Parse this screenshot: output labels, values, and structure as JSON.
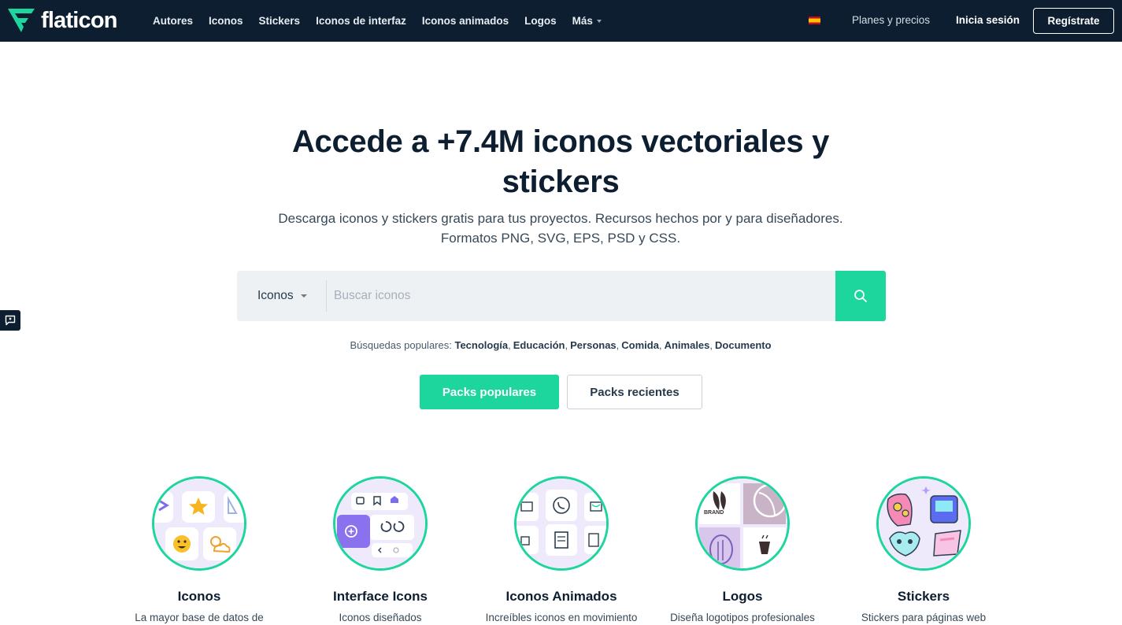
{
  "header": {
    "logo_text": "flaticon",
    "nav": [
      {
        "label": "Autores"
      },
      {
        "label": "Iconos"
      },
      {
        "label": "Stickers"
      },
      {
        "label": "Iconos de interfaz"
      },
      {
        "label": "Iconos animados"
      },
      {
        "label": "Logos"
      },
      {
        "label": "Más"
      }
    ],
    "language_flag_icon": "spain-flag-icon",
    "pricing_label": "Planes y precios",
    "login_label": "Inicia sesión",
    "register_label": "Regístrate"
  },
  "hero": {
    "title_line1": "Accede a +7.4M iconos vectoriales y",
    "title_line2": "stickers",
    "subtitle_line1": "Descarga iconos y stickers gratis para tus proyectos. Recursos hechos por y para diseñadores.",
    "subtitle_line2": "Formatos PNG, SVG, EPS, PSD y CSS."
  },
  "search": {
    "type_selected": "Iconos",
    "placeholder": "Buscar iconos",
    "value": ""
  },
  "popular": {
    "label": "Búsquedas populares:",
    "terms": [
      "Tecnología",
      "Educación",
      "Personas",
      "Comida",
      "Animales",
      "Documento"
    ]
  },
  "actions": {
    "popular_packs": "Packs populares",
    "recent_packs": "Packs recientes"
  },
  "categories": [
    {
      "title": "Iconos",
      "desc": "La mayor base de datos de"
    },
    {
      "title": "Interface Icons",
      "desc": "Iconos diseñados"
    },
    {
      "title": "Iconos Animados",
      "desc": "Increíbles iconos en movimiento"
    },
    {
      "title": "Logos",
      "desc": "Diseña logotipos profesionales"
    },
    {
      "title": "Stickers",
      "desc": "Stickers para páginas web"
    }
  ],
  "logo_brand_text": "BRAND",
  "colors": {
    "header_bg": "#0c1e2f",
    "accent_green": "#1dd69e",
    "search_bg": "#eef1f4"
  }
}
